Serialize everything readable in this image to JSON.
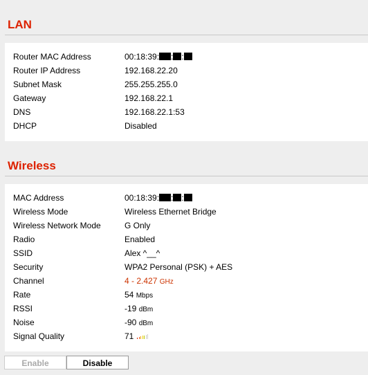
{
  "lan": {
    "title": "LAN",
    "rows": [
      {
        "label": "Router MAC Address",
        "value": "00:18:39:"
      },
      {
        "label": "Router IP Address",
        "value": "192.168.22.20"
      },
      {
        "label": "Subnet Mask",
        "value": "255.255.255.0"
      },
      {
        "label": "Gateway",
        "value": "192.168.22.1"
      },
      {
        "label": "DNS",
        "value": "192.168.22.1:53"
      },
      {
        "label": "DHCP",
        "value": "Disabled"
      }
    ]
  },
  "wireless": {
    "title": "Wireless",
    "rows": [
      {
        "label": "MAC Address",
        "value": "00:18:39:"
      },
      {
        "label": "Wireless Mode",
        "value": "Wireless Ethernet Bridge"
      },
      {
        "label": "Wireless Network Mode",
        "value": "G Only"
      },
      {
        "label": "Radio",
        "value": "Enabled"
      },
      {
        "label": "SSID",
        "value": "Alex ^__^"
      },
      {
        "label": "Security",
        "value": "WPA2 Personal (PSK) + AES"
      },
      {
        "label": "Channel",
        "value": "4 - 2.427",
        "unit": "GHz"
      },
      {
        "label": "Rate",
        "value": "54",
        "unit": "Mbps"
      },
      {
        "label": "RSSI",
        "value": "-19",
        "unit": "dBm"
      },
      {
        "label": "Noise",
        "value": "-90",
        "unit": "dBm"
      },
      {
        "label": "Signal Quality",
        "value": "71",
        "level": 0.71
      }
    ]
  },
  "buttons": {
    "enable": "Enable",
    "disable": "Disable"
  },
  "colors": {
    "section_title": "#dd2200",
    "channel_value": "#cc3300",
    "signal_bars": [
      "#d81e05",
      "#e85a0a",
      "#ee9a00",
      "#f0cc00",
      "#b8cc00",
      "#66b800",
      "#22aa00"
    ]
  }
}
